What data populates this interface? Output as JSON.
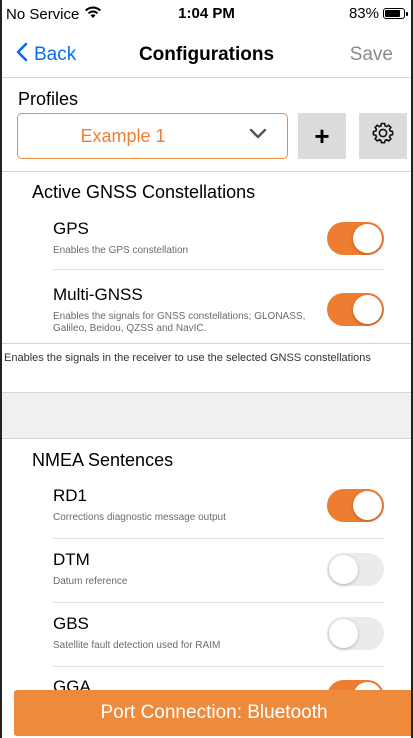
{
  "status_bar": {
    "carrier": "No Service",
    "time": "1:04 PM",
    "battery": "83%",
    "battery_level": 0.83
  },
  "nav": {
    "back_label": "Back",
    "title": "Configurations",
    "save_label": "Save"
  },
  "profiles": {
    "label": "Profiles",
    "selected": "Example 1",
    "add_label": "+"
  },
  "gnss": {
    "title": "Active GNSS Constellations",
    "items": [
      {
        "title": "GPS",
        "desc": "Enables the GPS constellation",
        "enabled": true
      },
      {
        "title": "Multi-GNSS",
        "desc": "Enables the signals for GNSS constellations; GLONASS, Galileo, Beidou, QZSS and NavIC.",
        "enabled": true
      }
    ],
    "note": "Enables the signals in the receiver to use the selected GNSS constellations"
  },
  "nmea": {
    "title": "NMEA Sentences",
    "items": [
      {
        "title": "RD1",
        "desc": "Corrections diagnostic message output",
        "enabled": true
      },
      {
        "title": "DTM",
        "desc": "Datum reference",
        "enabled": false
      },
      {
        "title": "GBS",
        "desc": "Satellite fault detection used for RAIM",
        "enabled": false
      },
      {
        "title": "GGA",
        "desc": "",
        "enabled": true
      }
    ]
  },
  "bottom_button": {
    "label": "Port Connection: Bluetooth"
  },
  "colors": {
    "accent": "#ee7d31",
    "link": "#0a6cf1",
    "toggle_off": "#ebebeb"
  }
}
